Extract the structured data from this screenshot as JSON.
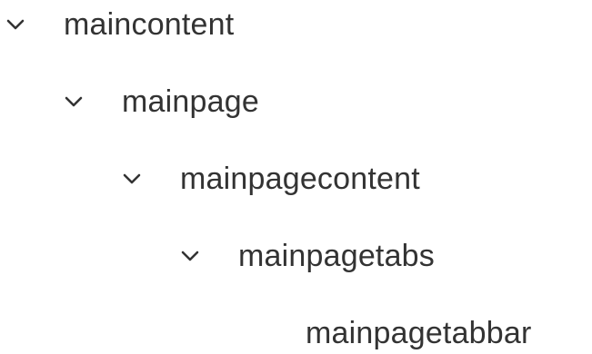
{
  "tree": {
    "nodes": [
      {
        "label": "maincontent",
        "expanded": true,
        "icon": "chevron-down-icon"
      },
      {
        "label": "mainpage",
        "expanded": true,
        "icon": "chevron-down-icon"
      },
      {
        "label": "mainpagecontent",
        "expanded": true,
        "icon": "chevron-down-icon"
      },
      {
        "label": "mainpagetabs",
        "expanded": true,
        "icon": "chevron-down-icon"
      },
      {
        "label": "mainpagetabbar"
      }
    ]
  }
}
